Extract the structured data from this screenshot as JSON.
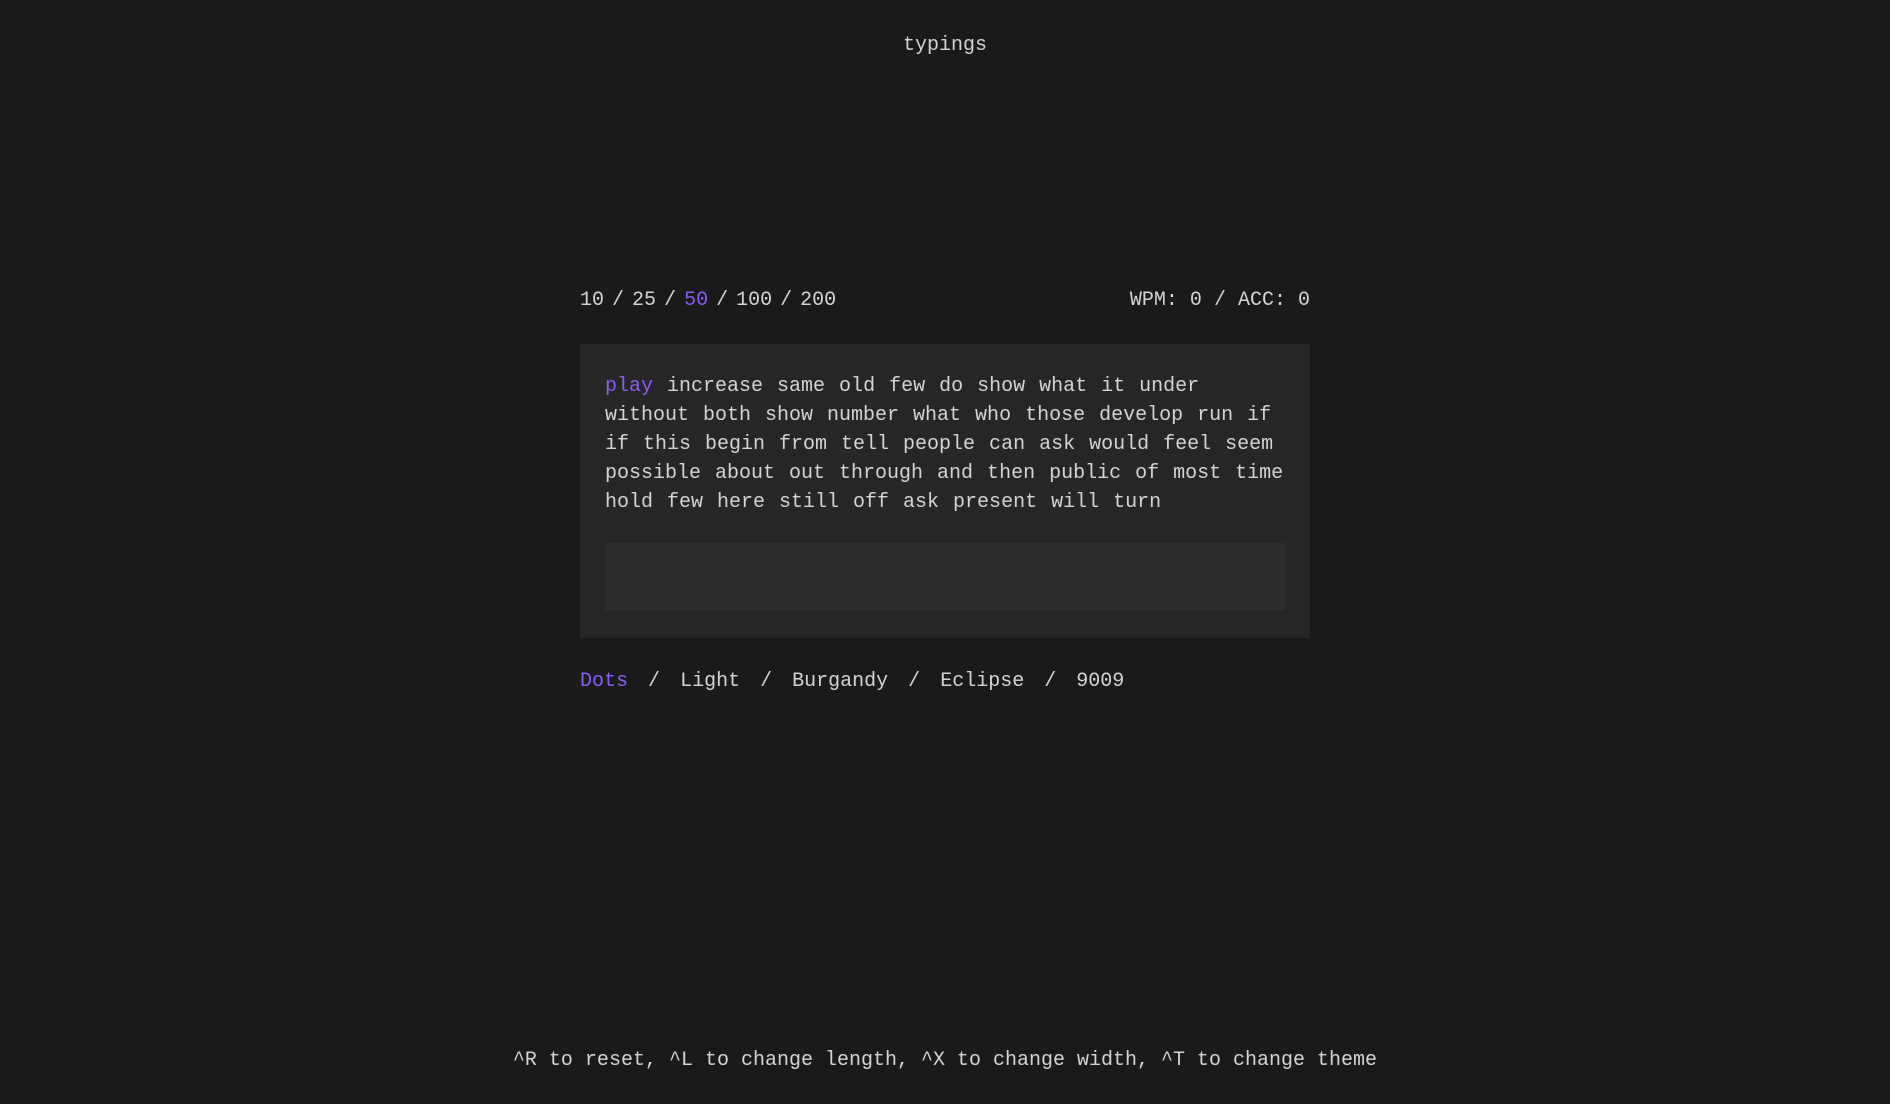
{
  "header": {
    "title": "typings"
  },
  "lengths": {
    "options": [
      "10",
      "25",
      "50",
      "100",
      "200"
    ],
    "active_index": 2,
    "separator": "/"
  },
  "stats": {
    "wpm_label": "WPM:",
    "wpm_value": "0",
    "acc_label": "ACC:",
    "acc_value": "0",
    "separator": "/"
  },
  "text": {
    "highlighted": "play",
    "rest": "increase same old few do show what it under without both show number what who those develop run if if this begin from tell people can ask would feel seem possible about out through and then public of most time hold few here still off ask present will turn"
  },
  "input": {
    "value": "",
    "placeholder": ""
  },
  "themes": {
    "options": [
      "Dots",
      "Light",
      "Burgandy",
      "Eclipse",
      "9009"
    ],
    "active_index": 0,
    "separator": "/"
  },
  "footer": {
    "text": "^R to reset, ^L to change length, ^X to change width, ^T to change theme"
  },
  "colors": {
    "background": "#1a1a1a",
    "panel": "#262626",
    "input_bg": "#2e2e2e",
    "text": "#d4d4d4",
    "accent": "#8a5cf6"
  }
}
